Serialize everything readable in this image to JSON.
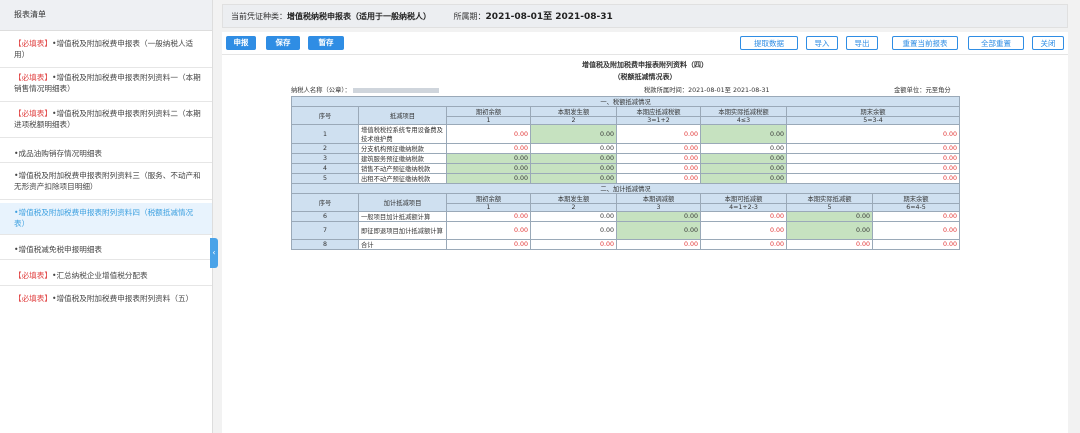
{
  "sidebar": {
    "title": "报表清单",
    "items": [
      {
        "tag": "【必填表】",
        "text": "•增值税及附加税费申报表（一般纳税人适用）",
        "active": false
      },
      {
        "tag": "【必填表】",
        "text": "•增值税及附加税费申报表附列资料一（本期销售情况明细表）",
        "active": false
      },
      {
        "tag": "【必填表】",
        "text": "•增值税及附加税费申报表附列资料二（本期进项税额明细表）",
        "active": false
      },
      {
        "tag": "",
        "text": "•成品油购销存情况明细表",
        "active": false
      },
      {
        "tag": "",
        "text": "•增值税及附加税费申报表附列资料三（服务、不动产和无形资产扣除项目明细）",
        "active": false
      },
      {
        "tag": "",
        "text": "•增值税及附加税费申报表附列资料四（税额抵减情况表）",
        "active": true
      },
      {
        "tag": "",
        "text": "•增值税减免税申报明细表",
        "active": false
      },
      {
        "tag": "【必填表】",
        "text": "•汇总纳税企业增值税分配表",
        "active": false
      },
      {
        "tag": "【必填表】",
        "text": "•增值税及附加税费申报表附列资料（五）",
        "active": false
      }
    ]
  },
  "topbar": {
    "type_label": "当前凭证种类：",
    "type_value": "增值税纳税申报表（适用于一般纳税人）",
    "period_label": "所属期：",
    "period_value": "2021-08-01至 2021-08-31"
  },
  "toolbar": {
    "declare": "申报",
    "save": "保存",
    "stage": "暂存",
    "fetch": "提取数据",
    "import": "导入",
    "export": "导出",
    "reset_current": "重置当前报表",
    "reset_all": "全部重置",
    "close": "关闭"
  },
  "report": {
    "title": "增值税及附加税费申报表附列资料（四）",
    "subtitle": "（税额抵减情况表）",
    "taxpayer_label": "纳税人名称（公章）：",
    "period_label": "税款所属时间：",
    "period_value": "2021-08-01至 2021-08-31",
    "unit_label": "金额单位：元至角分",
    "section1": {
      "title": "一、税额抵减情况",
      "headers": [
        "序号",
        "抵减项目",
        "期初余额",
        "本期发生额",
        "本期应抵减税额",
        "本期实际抵减税额",
        "期末余额"
      ],
      "codes": [
        "1",
        "2",
        "3=1+2",
        "4≤3",
        "5=3-4"
      ],
      "rows": [
        {
          "seq": "1",
          "name": "增值税税控系统专用设备费及技术维护费",
          "vals": [
            "0.00",
            "0.00",
            "0.00",
            "0.00",
            "0.00"
          ]
        },
        {
          "seq": "2",
          "name": "分支机构预征缴纳税款",
          "vals": [
            "0.00",
            "0.00",
            "0.00",
            "0.00",
            "0.00"
          ]
        },
        {
          "seq": "3",
          "name": "建筑服务预征缴纳税款",
          "vals": [
            "0.00",
            "0.00",
            "0.00",
            "0.00",
            "0.00"
          ]
        },
        {
          "seq": "4",
          "name": "销售不动产预征缴纳税款",
          "vals": [
            "0.00",
            "0.00",
            "0.00",
            "0.00",
            "0.00"
          ]
        },
        {
          "seq": "5",
          "name": "出租不动产预征缴纳税款",
          "vals": [
            "0.00",
            "0.00",
            "0.00",
            "0.00",
            "0.00"
          ]
        }
      ]
    },
    "section2": {
      "title": "二、加计抵减情况",
      "headers": [
        "序号",
        "加计抵减项目",
        "期初余额",
        "本期发生额",
        "本期调减额",
        "本期可抵减额",
        "本期实际抵减额",
        "期末余额"
      ],
      "codes": [
        "1",
        "2",
        "3",
        "4=1+2-3",
        "5",
        "6=4-5"
      ],
      "rows": [
        {
          "seq": "6",
          "name": "一般项目加计抵减额计算",
          "vals": [
            "0.00",
            "0.00",
            "0.00",
            "0.00",
            "0.00",
            "0.00"
          ]
        },
        {
          "seq": "7",
          "name": "即征即退项目加计抵减额计算",
          "vals": [
            "0.00",
            "0.00",
            "0.00",
            "0.00",
            "0.00",
            "0.00"
          ]
        },
        {
          "seq": "8",
          "name": "合计",
          "vals": [
            "0.00",
            "0.00",
            "0.00",
            "0.00",
            "0.00",
            "0.00"
          ]
        }
      ]
    }
  }
}
